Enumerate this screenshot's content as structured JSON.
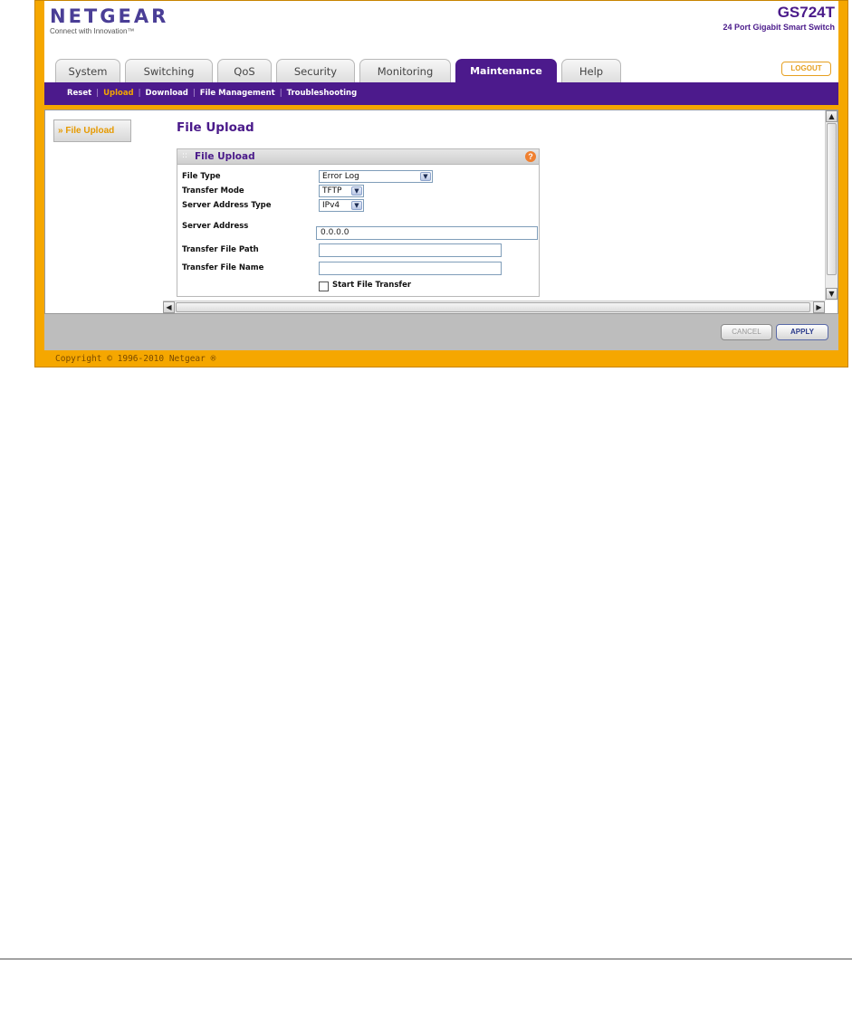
{
  "brand": {
    "logo": "NETGEAR",
    "tagline": "Connect with Innovation™",
    "model": "GS724T",
    "model_subtitle": "24 Port Gigabit Smart Switch",
    "logout_label": "LOGOUT"
  },
  "tabs": [
    {
      "label": "System"
    },
    {
      "label": "Switching"
    },
    {
      "label": "QoS"
    },
    {
      "label": "Security"
    },
    {
      "label": "Monitoring"
    },
    {
      "label": "Maintenance",
      "active": true
    },
    {
      "label": "Help"
    }
  ],
  "subnav": [
    {
      "label": "Reset"
    },
    {
      "label": "Upload",
      "active": true
    },
    {
      "label": "Download"
    },
    {
      "label": "File Management"
    },
    {
      "label": "Troubleshooting"
    }
  ],
  "sidebar": {
    "item_label": "File Upload",
    "item_prefix": "»"
  },
  "page": {
    "title": "File Upload"
  },
  "panel": {
    "title": "File Upload",
    "grip": "::",
    "help": "?",
    "fields": {
      "file_type": {
        "label": "File Type",
        "value": "Error Log"
      },
      "transfer_mode": {
        "label": "Transfer Mode",
        "value": "TFTP"
      },
      "server_address_type": {
        "label": "Server Address Type",
        "value": "IPv4"
      },
      "server_address": {
        "label": "Server Address",
        "value": "0.0.0.0"
      },
      "transfer_file_path": {
        "label": "Transfer File Path",
        "value": ""
      },
      "transfer_file_name": {
        "label": "Transfer File Name",
        "value": ""
      }
    },
    "start_transfer_label": "Start File Transfer"
  },
  "buttons": {
    "cancel": "CANCEL",
    "apply": "APPLY"
  },
  "footer": {
    "copyright": "Copyright © 1996-2010 Netgear ®"
  },
  "colors": {
    "brand_purple": "#4c1a8c",
    "accent_orange": "#f5a700"
  }
}
